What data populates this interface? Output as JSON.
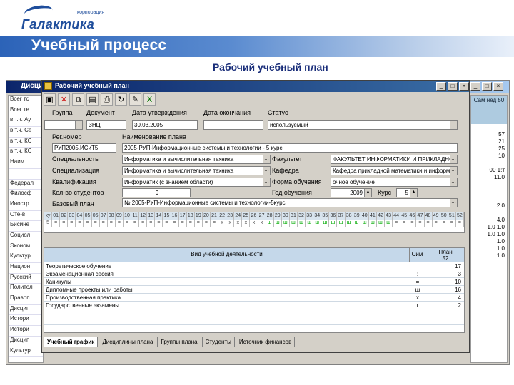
{
  "logo": {
    "corp": "корпорация",
    "word": "Галактика"
  },
  "header": {
    "title": "Учебный процесс",
    "subtitle": "Рабочий учебный план"
  },
  "bgwin": {
    "title": "Дисци...",
    "left_rows": [
      "Всег тс",
      "Всег те",
      "в т.ч. Ау",
      "в т.ч. Се",
      "в т.ч. КС",
      "в т.ч. КС",
      "Наим",
      "",
      "Федерал",
      "Филосф",
      "Иностр",
      "Оте-в",
      "Бисине",
      "Социол",
      "Эконом",
      "Культур",
      "Национ",
      "Русский",
      "Политол",
      "Правоп",
      "Дисцип",
      "Истори",
      "Истори",
      "Дисцип",
      "Культур"
    ],
    "right_header": "Сам нед 50",
    "right_vals": [
      "",
      "57",
      "21",
      "25",
      "10",
      "",
      "00 1:т",
      "11.0",
      "",
      "",
      "",
      "2.0",
      "",
      "4.0",
      "1.0 1.0",
      "1.0 1.0",
      "1.0",
      "1.0",
      "1.0",
      "",
      "",
      "",
      "",
      ""
    ]
  },
  "dialog": {
    "title": "Рабочий учебный план"
  },
  "toolbar": [
    "save-icon",
    "delete-icon",
    "copy-icon",
    "paste-icon",
    "print-icon",
    "refresh-icon",
    "edit-icon",
    "excel-icon"
  ],
  "form": {
    "group_label": "Группа",
    "document_label": "Документ",
    "approve_date_label": "Дата утверждения",
    "end_date_label": "Дата окончания",
    "status_label": "Статус",
    "document": "ЗНЦ",
    "approve_date": "30.03.2005",
    "status": "используемый",
    "regnum_label": "Рег.номер",
    "name_label": "Наименование плана",
    "regnum": "РУП2005.ИСиТ5",
    "name": "2005-РУП-Информационные системы и технологии - 5 курс",
    "spec_label": "Специальность",
    "spec": "Информатика и вычислительная техника",
    "faculty_label": "Факультет",
    "faculty": "ФАКУЛЬТЕТ ИНФОРМАТИКИ И ПРИКЛАДНОЙ",
    "specialization_label": "Специализация",
    "specialization": "Информатика и вычислительная техника",
    "dept_label": "Кафедра",
    "dept": "Кафедра прикладной математики и информ",
    "qual_label": "Квалификация",
    "qual": "Информатик (с знанием области)",
    "form_label": "Форма обучения",
    "form_value": "очное обучение",
    "students_label": "Кол-во студентов",
    "students": "9",
    "year_label": "Год обучения",
    "year": "2009",
    "course_label": "Курс",
    "course": "5",
    "base_label": "Базовый план",
    "base": "№ 2005-РУП-Информационные системы и технологии-5курс"
  },
  "weeks": {
    "header": [
      "ку",
      "01",
      "02",
      "03",
      "04",
      "05",
      "06",
      "07",
      "08",
      "09",
      "10",
      "11",
      "12",
      "13",
      "14",
      "15",
      "16",
      "17",
      "18",
      "19",
      "20",
      "21",
      "22",
      "23",
      "24",
      "25",
      "26",
      "27",
      "28",
      "29",
      "30",
      "31",
      "32",
      "33",
      "34",
      "35",
      "36",
      "37",
      "38",
      "39",
      "40",
      "41",
      "42",
      "43",
      "44",
      "45",
      "46",
      "47",
      "48",
      "49",
      "50",
      "51",
      "52"
    ],
    "row1": [
      "5",
      "=",
      "=",
      "=",
      "=",
      "=",
      "=",
      "=",
      "=",
      "=",
      "=",
      "=",
      "=",
      "=",
      "=",
      "=",
      "=",
      "=",
      "=",
      "=",
      "=",
      "=",
      "x",
      "x",
      "x",
      "x",
      "x",
      "x",
      "ш",
      "ш",
      "ш",
      "ш",
      "ш",
      "ш",
      "ш",
      "ш",
      "ш",
      "ш",
      "ш",
      "ш",
      "ш",
      "ш",
      "ш",
      "ш",
      "=",
      "=",
      "=",
      "=",
      "=",
      "=",
      "=",
      "=",
      "="
    ]
  },
  "grid": {
    "col_activity": "Вид учебной деятельности",
    "col_sym": "Сим",
    "col_plan": "План",
    "col_plan_sub": "52",
    "rows": [
      {
        "a": "Теоретическое обучение",
        "b": "",
        "d": "17"
      },
      {
        "a": "Экзаменационная сессия",
        "b": ":",
        "d": "3"
      },
      {
        "a": "Каникулы",
        "b": "=",
        "d": "10"
      },
      {
        "a": "Дипломные проекты или работы",
        "b": "ш",
        "d": "16"
      },
      {
        "a": "Производственная практика",
        "b": "x",
        "d": "4"
      },
      {
        "a": "Государственные экзамены",
        "b": "г",
        "d": "2"
      },
      {
        "a": "",
        "b": "",
        "d": ""
      },
      {
        "a": "",
        "b": "",
        "d": ""
      }
    ]
  },
  "tabs": [
    "Учебный график",
    "Дисциплины плана",
    "Группы плана",
    "Студенты",
    "Источник финансов"
  ]
}
